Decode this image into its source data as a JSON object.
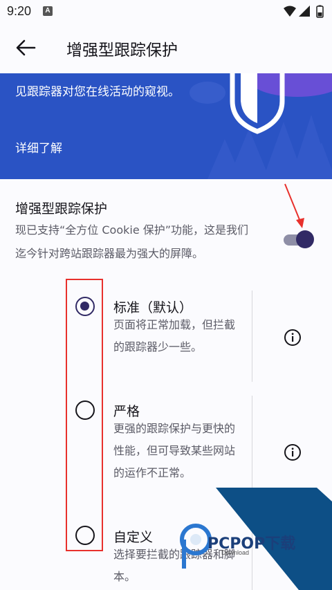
{
  "status_bar": {
    "time": "9:20",
    "notification_badge": "A",
    "icons": [
      "wifi-icon",
      "signal-icon",
      "battery-icon"
    ]
  },
  "toolbar": {
    "title": "增强型跟踪保护",
    "back_icon": "arrow-left-icon"
  },
  "banner": {
    "text": "见跟踪器对您在线活动的窥视。",
    "learn_more": "详细了解",
    "background": "#2a53c4"
  },
  "etp": {
    "title": "增强型跟踪保护",
    "description": "现已支持“全方位 Cookie 保护”功能，这是我们迄今针对跨站跟踪器最为强大的屏障。",
    "enabled": true
  },
  "options": [
    {
      "title": "标准（默认）",
      "description": "页面将正常加载，但拦截的跟踪器少一些。",
      "selected": true
    },
    {
      "title": "严格",
      "description": "更强的跟踪保护与更快的性能，但可导致某些网站的运作不正常。",
      "selected": false
    },
    {
      "title": "自定义",
      "description": "选择要拦截的跟踪器和脚本。",
      "selected": false
    }
  ],
  "watermark": {
    "text": "PCPOP下载",
    "subtext": "Download"
  },
  "colors": {
    "accent": "#312a65",
    "annotation_red": "#e8302c",
    "banner_blue": "#2a53c4"
  }
}
